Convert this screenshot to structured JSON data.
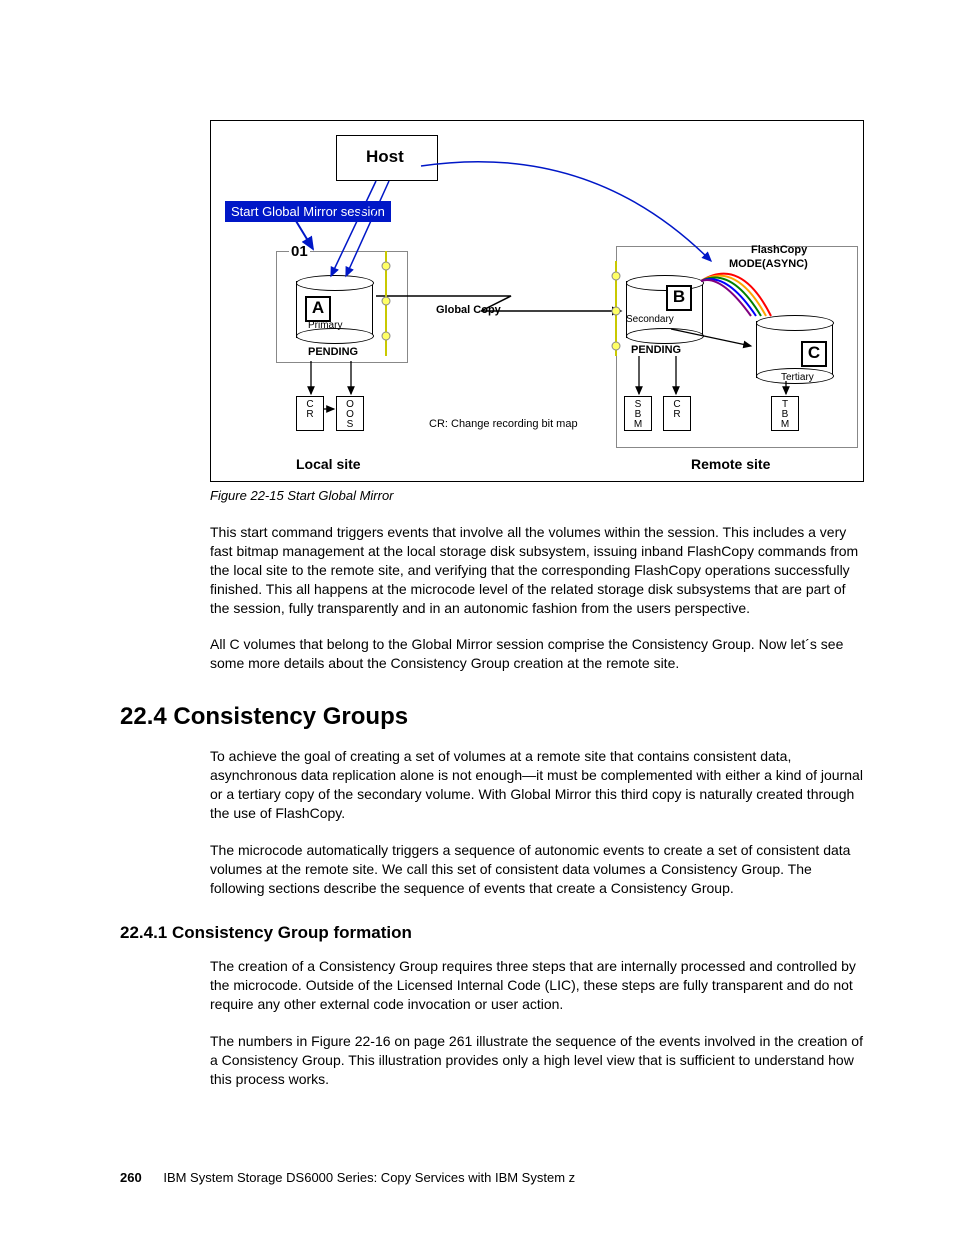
{
  "figure": {
    "host": "Host",
    "start_label": "Start Global Mirror session",
    "step": "01",
    "A": "A",
    "primary": "Primary",
    "pendingA": "PENDING",
    "CR": "C\nR",
    "OOS": "O\nO\nS",
    "global_copy": "Global Copy",
    "cr_note": "CR: Change recording bit map",
    "local": "Local site",
    "B": "B",
    "secondary": "Secondary",
    "pendingB": "PENDING",
    "SBM": "S\nB\nM",
    "CR2": "C\nR",
    "flashcopy": "FlashCopy",
    "mode": "MODE(ASYNC)",
    "C": "C",
    "tertiary": "Tertiary",
    "TBM": "T\nB\nM",
    "remote": "Remote site"
  },
  "caption": "Figure 22-15   Start Global Mirror",
  "p1": "This start command triggers events that involve all the volumes within the session. This includes a very fast bitmap management at the local storage disk subsystem, issuing inband FlashCopy commands from the local site to the remote site, and verifying that the corresponding FlashCopy operations successfully finished. This all happens at the microcode level of the related storage disk subsystems that are part of the session, fully transparently and in an autonomic fashion from the users perspective.",
  "p2": "All C volumes that belong to the Global Mirror session comprise the Consistency Group. Now let´s see some more details about the Consistency Group creation at the remote site.",
  "h2": "22.4  Consistency Groups",
  "p3": "To achieve the goal of creating a set of volumes at a remote site that contains consistent data, asynchronous data replication alone is not enough—it must be complemented with either a kind of journal or a tertiary copy of the secondary volume. With Global Mirror this third copy is naturally created through the use of FlashCopy.",
  "p4": "The microcode automatically triggers a sequence of autonomic events to create a set of consistent data volumes at the remote site. We call this set of consistent data volumes a Consistency Group. The following sections describe the sequence of events that create a Consistency Group.",
  "h3": "22.4.1  Consistency Group formation",
  "p5": "The creation of a Consistency Group requires three steps that are internally processed and controlled by the microcode. Outside of the Licensed Internal Code (LIC), these steps are fully transparent and do not require any other external code invocation or user action.",
  "p6": "The numbers in Figure 22-16 on page 261 illustrate the sequence of the events involved in the creation of a Consistency Group. This illustration provides only a high level view that is sufficient to understand how this process works.",
  "footer_page": "260",
  "footer_text": "IBM System Storage DS6000 Series: Copy Services with IBM System z"
}
